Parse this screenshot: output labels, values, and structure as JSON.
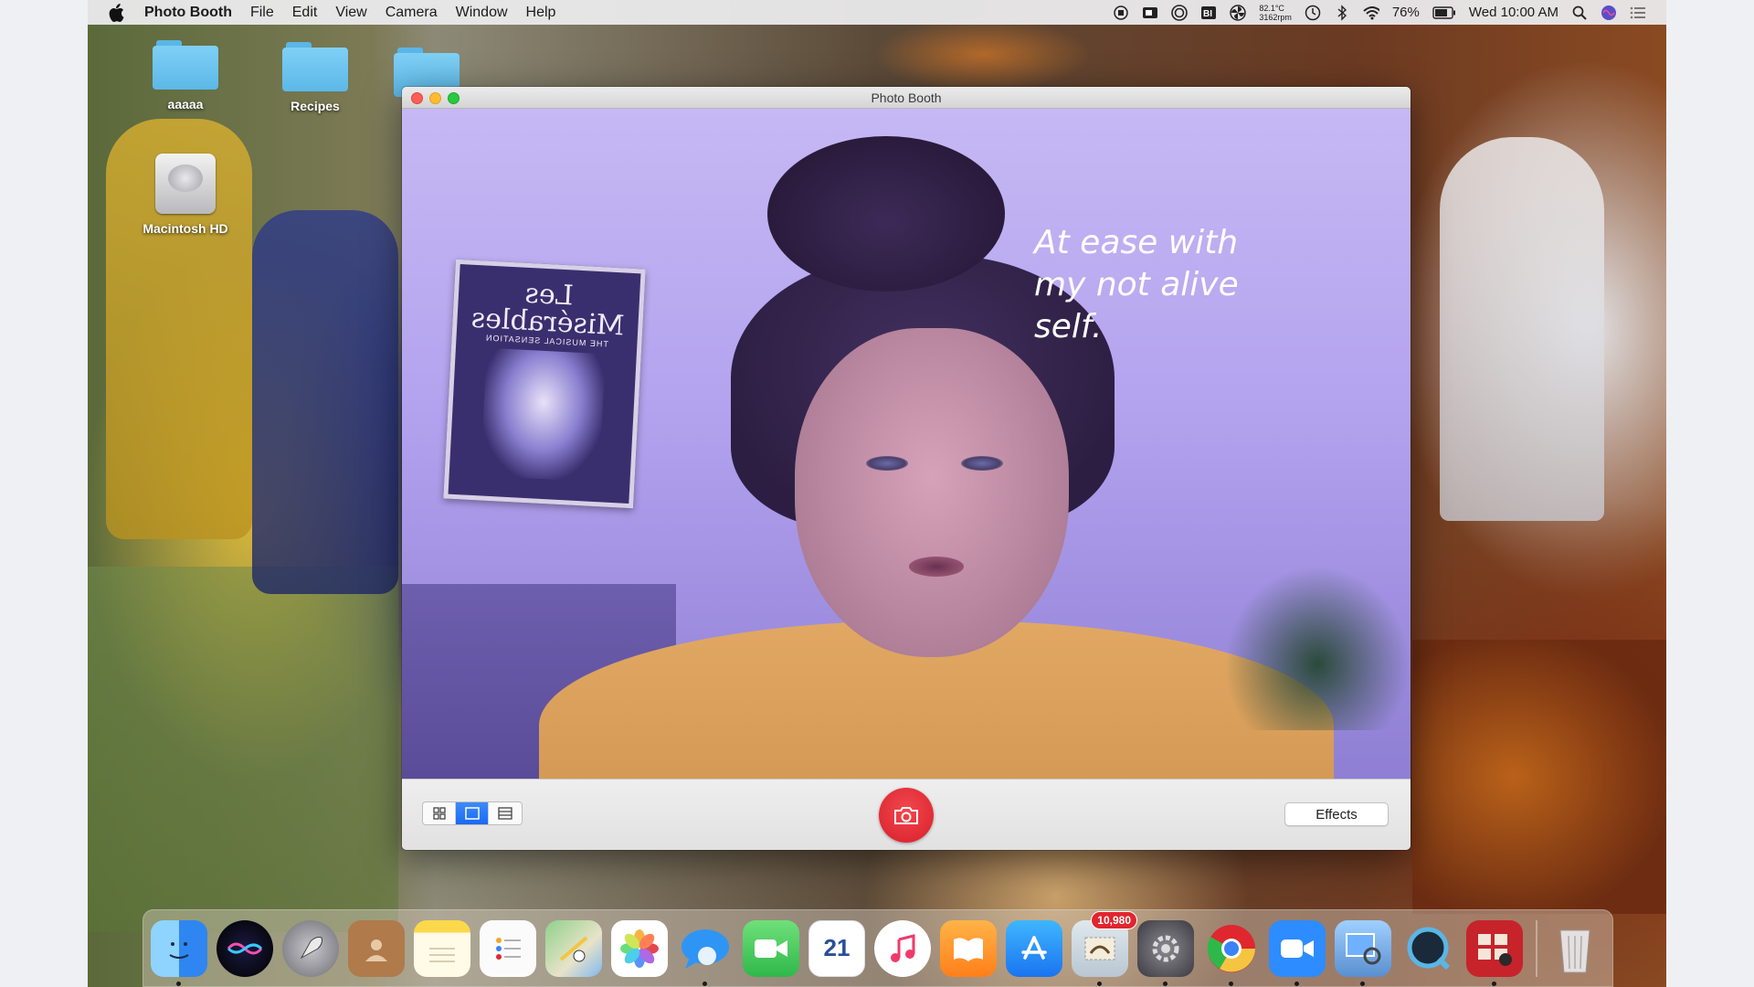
{
  "menubar": {
    "app_name": "Photo Booth",
    "menus": [
      "File",
      "Edit",
      "View",
      "Camera",
      "Window",
      "Help"
    ],
    "temperature": "82.1°C",
    "fan_speed": "3162rpm",
    "battery": "76%",
    "datetime": "Wed 10:00 AM"
  },
  "desktop": {
    "icons": [
      {
        "label": "aaaaa",
        "icon": "folder-icon"
      },
      {
        "label": "Recipes",
        "icon": "folder-icon"
      },
      {
        "label": "",
        "icon": "folder-icon"
      },
      {
        "label": "Macintosh HD",
        "icon": "hard-drive-icon"
      }
    ]
  },
  "window": {
    "title": "Photo Booth",
    "caption": "At ease with my not alive self.",
    "poster_title": "Les Misérables",
    "poster_subtitle": "THE MUSICAL SENSATION",
    "view_modes": [
      "grid",
      "single",
      "filmstrip"
    ],
    "active_view": "single",
    "effects_label": "Effects"
  },
  "dock": {
    "apps": [
      "Finder",
      "Siri",
      "Launchpad",
      "Contacts",
      "Notes",
      "Reminders",
      "Maps",
      "Photos",
      "Messages",
      "FaceTime",
      "Calendar",
      "iTunes",
      "iBooks",
      "App Store",
      "Mail",
      "System Preferences",
      "Chrome",
      "Zoom",
      "Preview",
      "QuickTime",
      "Photo Booth",
      "Trash"
    ],
    "calendar_date": "21",
    "mail_badge": "10,980"
  },
  "colors": {
    "shutter_red": "#e3282f",
    "active_blue": "#1a6af0",
    "caption_white": "#ffffff"
  }
}
